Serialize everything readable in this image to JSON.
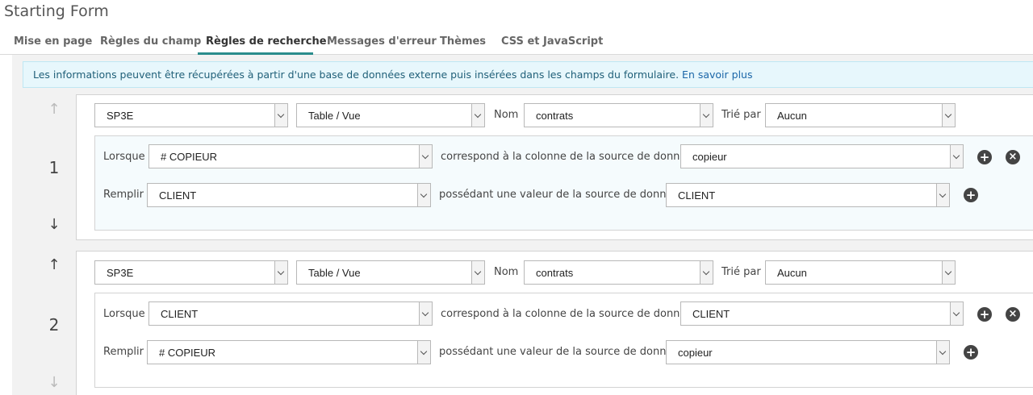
{
  "page": {
    "title": "Starting Form"
  },
  "tabs": [
    {
      "label": "Mise en page"
    },
    {
      "label": "Règles du champ"
    },
    {
      "label": "Règles de recherche"
    },
    {
      "label": "Messages d'erreur"
    },
    {
      "label": "Thèmes"
    },
    {
      "label": "CSS et JavaScript"
    }
  ],
  "info": {
    "text": "Les informations peuvent être récupérées à partir d'une base de données externe puis insérées dans les champs du formulaire.",
    "link": "En savoir plus"
  },
  "labels": {
    "nom": "Nom",
    "trie_par": "Trié par",
    "lorsque": "Lorsque",
    "remplir": "Remplir",
    "correspond": "correspond à la colonne de la source de données",
    "possedant": "possédant une valeur de la source de données"
  },
  "icons": {
    "up": "arrow-up-icon",
    "down": "arrow-down-icon",
    "add": "plus-circle-icon",
    "remove": "close-circle-icon"
  },
  "colors": {
    "accent": "#2a8c8c",
    "info_bg": "#e7f7fc",
    "link": "#1a66a8"
  },
  "rules": [
    {
      "number": "1",
      "source": "SP3E",
      "type": "Table / Vue",
      "nom": "contrats",
      "trie_par": "Aucun",
      "lorsque_field": "# COPIEUR",
      "lorsque_column": "copieur",
      "remplir_field": "CLIENT",
      "remplir_value": "CLIENT"
    },
    {
      "number": "2",
      "source": "SP3E",
      "type": "Table / Vue",
      "nom": "contrats",
      "trie_par": "Aucun",
      "lorsque_field": "CLIENT",
      "lorsque_column": "CLIENT",
      "remplir_field": "# COPIEUR",
      "remplir_value": "copieur"
    }
  ]
}
